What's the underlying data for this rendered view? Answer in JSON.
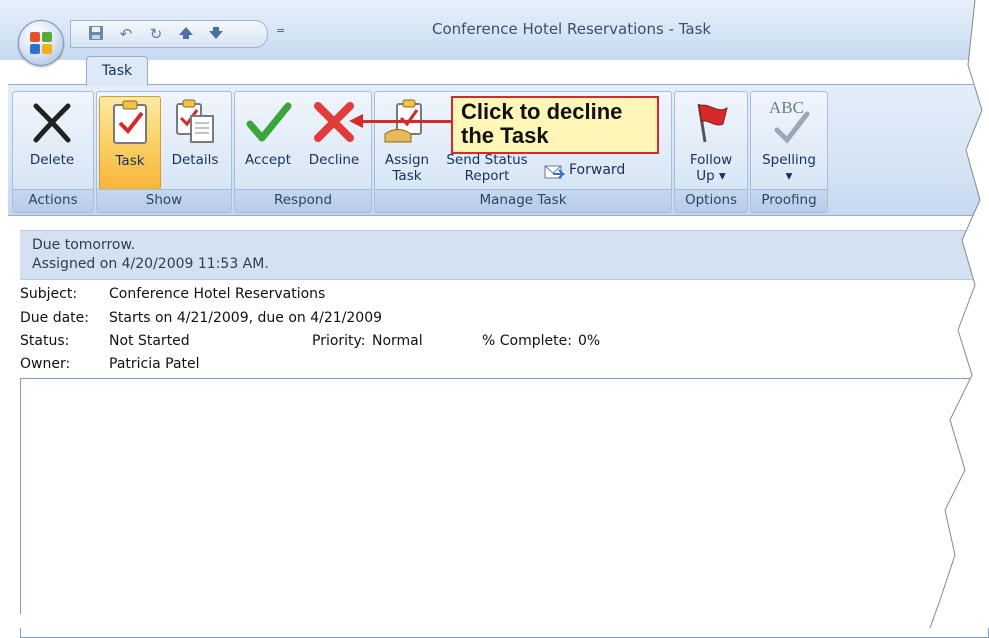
{
  "window": {
    "title": "Conference Hotel Reservations - Task",
    "qat_dropdown": "="
  },
  "tabs": [
    {
      "label": "Task",
      "active": true
    }
  ],
  "ribbon": {
    "groups": {
      "actions": {
        "label": "Actions",
        "buttons": {
          "delete": "Delete"
        }
      },
      "show": {
        "label": "Show",
        "buttons": {
          "task": "Task",
          "details": "Details"
        }
      },
      "respond": {
        "label": "Respond",
        "buttons": {
          "accept": "Accept",
          "decline": "Decline"
        }
      },
      "manage": {
        "label": "Manage Task",
        "buttons": {
          "assign_line1": "Assign",
          "assign_line2": "Task",
          "send_line1": "Send Status",
          "send_line2": "Report",
          "forward": "Forward"
        }
      },
      "options": {
        "label": "Options",
        "buttons": {
          "follow_line1": "Follow",
          "follow_line2": "Up ▾"
        }
      },
      "proofing": {
        "label": "Proofing",
        "buttons": {
          "spelling": "Spelling",
          "spelling_drop": "▾",
          "abc": "ABC"
        }
      }
    }
  },
  "callout": {
    "line1": "Click to decline",
    "line2": "the Task"
  },
  "infobar": {
    "line1": "Due tomorrow.",
    "line2": "Assigned on 4/20/2009 11:53 AM."
  },
  "fields": {
    "subject_label": "Subject:",
    "subject_value": "Conference Hotel Reservations",
    "due_label": "Due date:",
    "due_value": "Starts on 4/21/2009, due on 4/21/2009",
    "status_label": "Status:",
    "status_value": "Not Started",
    "priority_label": "Priority:",
    "priority_value": "Normal",
    "complete_label": "% Complete:",
    "complete_value": "0%",
    "owner_label": "Owner:",
    "owner_value": "Patricia Patel"
  },
  "colors": {
    "accent_red": "#d42a2a",
    "accept_green": "#3aa63a",
    "ribbon_blue": "#d3e2f4"
  }
}
